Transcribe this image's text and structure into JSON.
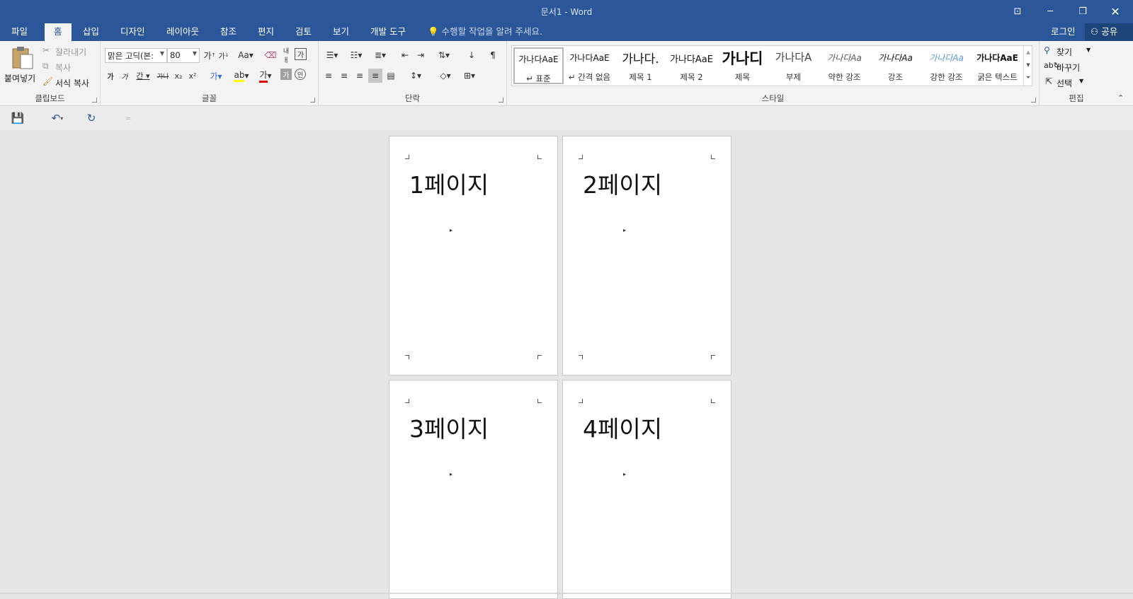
{
  "window": {
    "title": "문서1 - Word"
  },
  "tabs": [
    "파일",
    "홈",
    "삽입",
    "디자인",
    "레이아웃",
    "참조",
    "편지",
    "검토",
    "보기",
    "개발 도구"
  ],
  "active_tab": "홈",
  "tell_me": "수행할 작업을 알려 주세요.",
  "account": {
    "login": "로그인",
    "share": "공유"
  },
  "clipboard": {
    "paste": "붙여넣기",
    "cut": "잘라내기",
    "copy": "복사",
    "format_painter": "서식 복사",
    "label": "클립보드"
  },
  "font": {
    "name": "맑은 고딕(본:",
    "size": "80",
    "label": "글꼴"
  },
  "paragraph": {
    "label": "단락"
  },
  "styles": {
    "label": "스타일",
    "items": [
      {
        "preview": "가나다AaE",
        "name": "↵ 표준"
      },
      {
        "preview": "가나다AaE",
        "name": "↵ 간격 없음"
      },
      {
        "preview": "가나다.",
        "name": "제목 1"
      },
      {
        "preview": "가나다AaE",
        "name": "제목 2"
      },
      {
        "preview": "가나디",
        "name": "제목"
      },
      {
        "preview": "가나다A",
        "name": "부제"
      },
      {
        "preview": "가나다Aa",
        "name": "약한 강조"
      },
      {
        "preview": "가나다Aa",
        "name": "강조"
      },
      {
        "preview": "가나다Aa",
        "name": "강한 강조"
      },
      {
        "preview": "가나다AaE",
        "name": "굵은 텍스트"
      }
    ]
  },
  "editing": {
    "find": "찾기",
    "replace": "바꾸기",
    "select": "선택",
    "label": "편집"
  },
  "document": {
    "pages": [
      "1페이지",
      "2페이지",
      "3페이지",
      "4페이지"
    ]
  },
  "colors": {
    "brand": "#2b579a",
    "highlight": "#ffff00",
    "font_color": "#e00000"
  }
}
